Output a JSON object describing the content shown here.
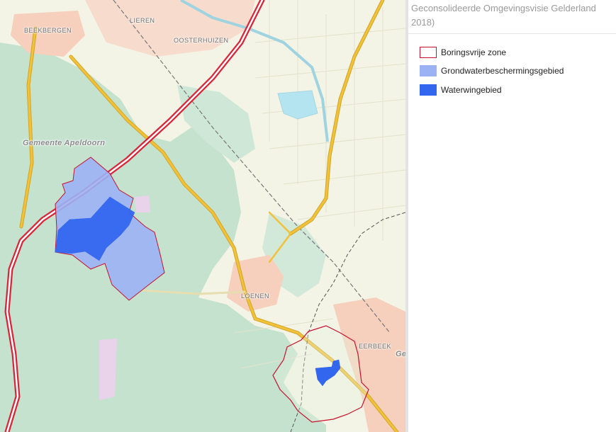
{
  "map": {
    "places": [
      {
        "id": "beekbergen",
        "label": "BEEKBERGEN"
      },
      {
        "id": "lieren",
        "label": "LIEREN"
      },
      {
        "id": "oosterhuizen",
        "label": "OOSTERHUIZEN"
      },
      {
        "id": "gemeente-apeldoorn",
        "label": "Gemeente Apeldoorn"
      },
      {
        "id": "loenen",
        "label": "LOENEN"
      },
      {
        "id": "eerbeek",
        "label": "EERBEEK"
      },
      {
        "id": "edge-g",
        "label": "Ge"
      }
    ]
  },
  "legend": {
    "title": "Geconsolideerde Omgevingsvisie Gelderland 2018)",
    "items": [
      {
        "label": "Boringsvrije zone",
        "fill": "#ffffff",
        "stroke": "#c8102e"
      },
      {
        "label": "Grondwaterbeschermingsgebied",
        "fill": "#9bb3f5",
        "stroke": "#9bb3f5"
      },
      {
        "label": "Waterwingebied",
        "fill": "#3366ee",
        "stroke": "#3366ee"
      }
    ]
  },
  "colors": {
    "forest": "#c5e2cf",
    "built": "#f6d0bc",
    "water": "#b4e4f0",
    "highway": "#d9253a",
    "main-road": "#f2c13a"
  }
}
